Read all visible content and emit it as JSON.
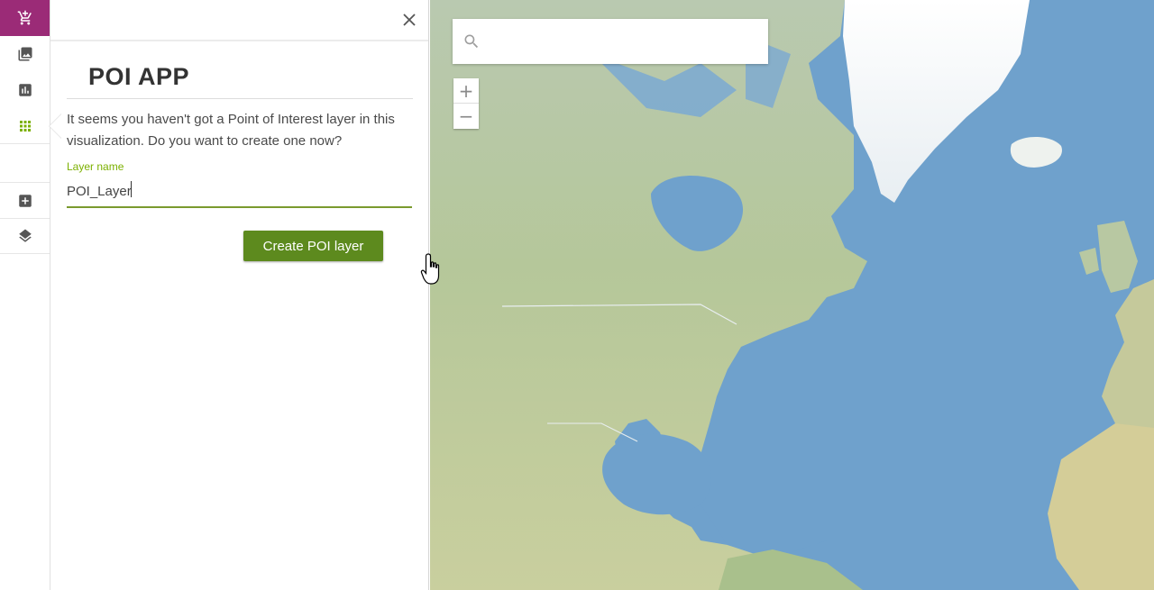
{
  "rail": {
    "icons": [
      "cart-plus-icon",
      "gallery-icon",
      "bar-chart-icon",
      "apps-grid-icon",
      "add-box-icon",
      "layers-icon"
    ],
    "active_color": "#9b2b77",
    "apps_color": "#7cb000"
  },
  "panel": {
    "title": "POI APP",
    "message": "It seems you haven't got a Point of Interest layer in this visualization. Do you want to create one now?",
    "layer_name_label": "Layer name",
    "layer_name_value": "POI_Layer",
    "create_button_label": "Create POI layer",
    "button_color": "#5d8a1e"
  },
  "map": {
    "search_placeholder": "",
    "zoom_in_label": "+",
    "zoom_out_label": "−"
  }
}
